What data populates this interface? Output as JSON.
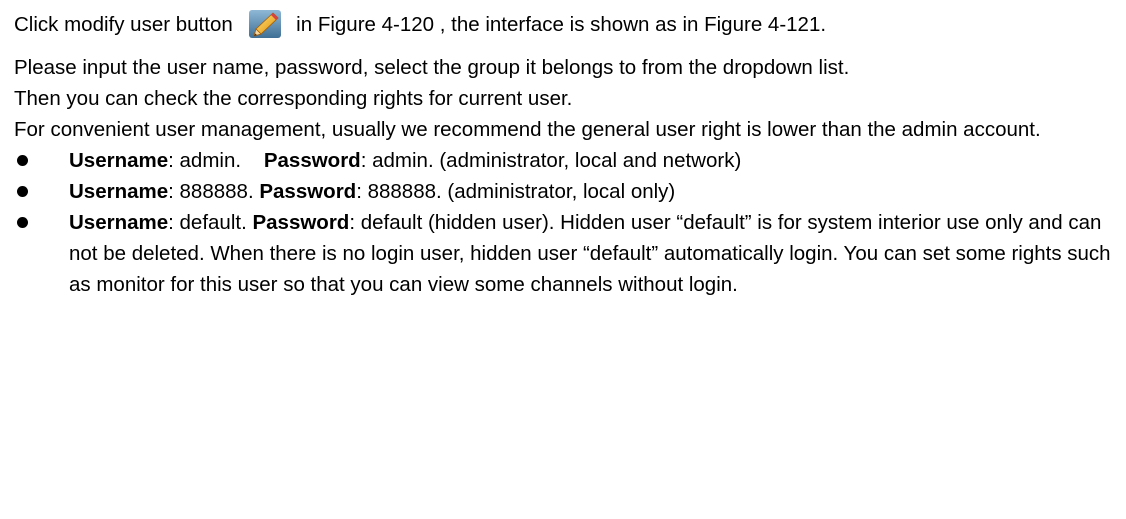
{
  "intro": {
    "text_before_icon": "Click modify user button",
    "icon": "pencil-edit-icon",
    "text_after_icon": "in Figure 4-120 , the interface is shown as in Figure 4-121."
  },
  "paragraphs": [
    "Please input the user name, password, select the group it belongs to from the dropdown list.",
    "Then you can check the corresponding rights for current user.",
    "For convenient user management, usually we recommend the general user right is lower than the admin account."
  ],
  "accounts": [
    {
      "username_label": "Username",
      "username_value": ": admin.",
      "password_label": "Password",
      "password_value": ": admin. (administrator, local and network)"
    },
    {
      "username_label": "Username",
      "username_value": ": 888888.",
      "password_label": "Password",
      "password_value": ": 888888. (administrator, local only)"
    },
    {
      "username_label": "Username",
      "username_value": ": default.",
      "password_label": "Password",
      "password_value": ": default (hidden user). Hidden user “default” is for system interior use only and can not be deleted. When there is no login user, hidden user “default” automatically login. You can set some rights such as monitor for this user so that you can view some channels without login."
    }
  ]
}
